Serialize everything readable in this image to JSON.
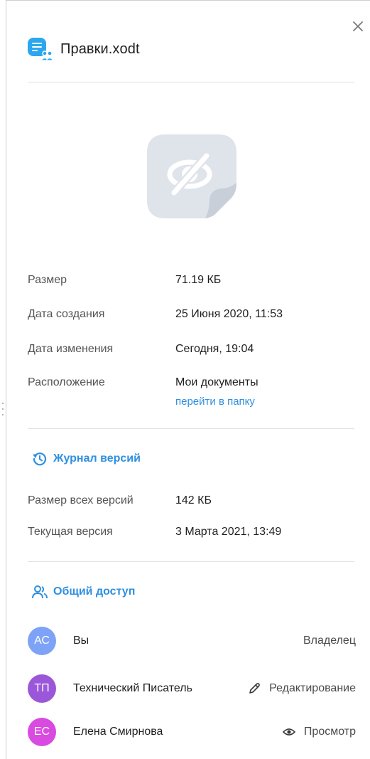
{
  "file": {
    "name": "Правки.xodt"
  },
  "icons": {
    "close": "close-icon",
    "file": "document-shared-icon",
    "preview": "hidden-preview-icon",
    "history": "history-icon",
    "share": "users-icon",
    "edit": "pencil-icon",
    "view": "eye-icon"
  },
  "info": {
    "size_label": "Размер",
    "size_value": "71.19 КБ",
    "created_label": "Дата создания",
    "created_value": "25 Июня 2020, 11:53",
    "modified_label": "Дата изменения",
    "modified_value": "Сегодня, 19:04",
    "location_label": "Расположение",
    "location_value": "Мои документы",
    "location_link": "перейти в папку"
  },
  "versions": {
    "title": "Журнал версий",
    "total_label": "Размер всех версий",
    "total_value": "142 КБ",
    "current_label": "Текущая версия",
    "current_value": "3 Марта 2021, 13:49"
  },
  "sharing": {
    "title": "Общий доступ",
    "users": [
      {
        "initials": "АС",
        "name": "Вы",
        "access": "Владелец",
        "color": "#7da2f7"
      },
      {
        "initials": "ТП",
        "name": "Технический Писатель",
        "access": "Редактирование",
        "color": "#9b57d9"
      },
      {
        "initials": "ЕС",
        "name": "Елена Смирнова",
        "access": "Просмотр",
        "color": "#d94ae0"
      }
    ]
  },
  "colors": {
    "accent": "#2f8fe0",
    "file_icon": "#2aa7ee",
    "preview_bg": "#dfe3ea"
  }
}
